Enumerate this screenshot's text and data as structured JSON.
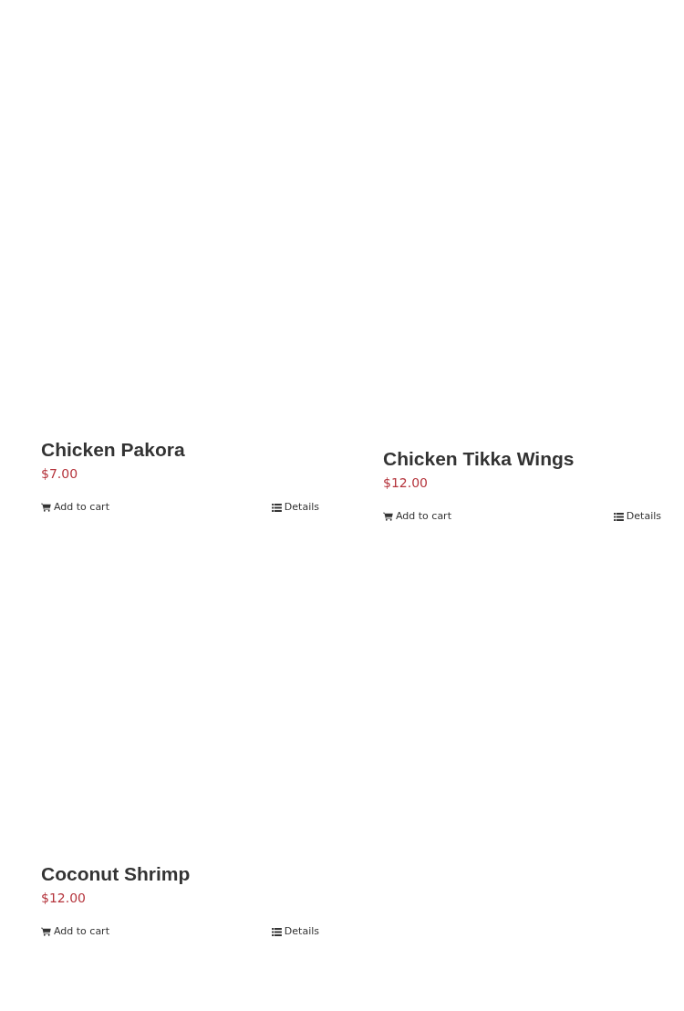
{
  "products": [
    {
      "name": "Chicken Pakora",
      "price": "$7.00",
      "add_to_cart": "Add to cart",
      "details": "Details"
    },
    {
      "name": "Chicken Tikka Wings",
      "price": "$12.00",
      "add_to_cart": "Add to cart",
      "details": "Details"
    },
    {
      "name": "Coconut Shrimp",
      "price": "$12.00",
      "add_to_cart": "Add to cart",
      "details": "Details"
    }
  ]
}
